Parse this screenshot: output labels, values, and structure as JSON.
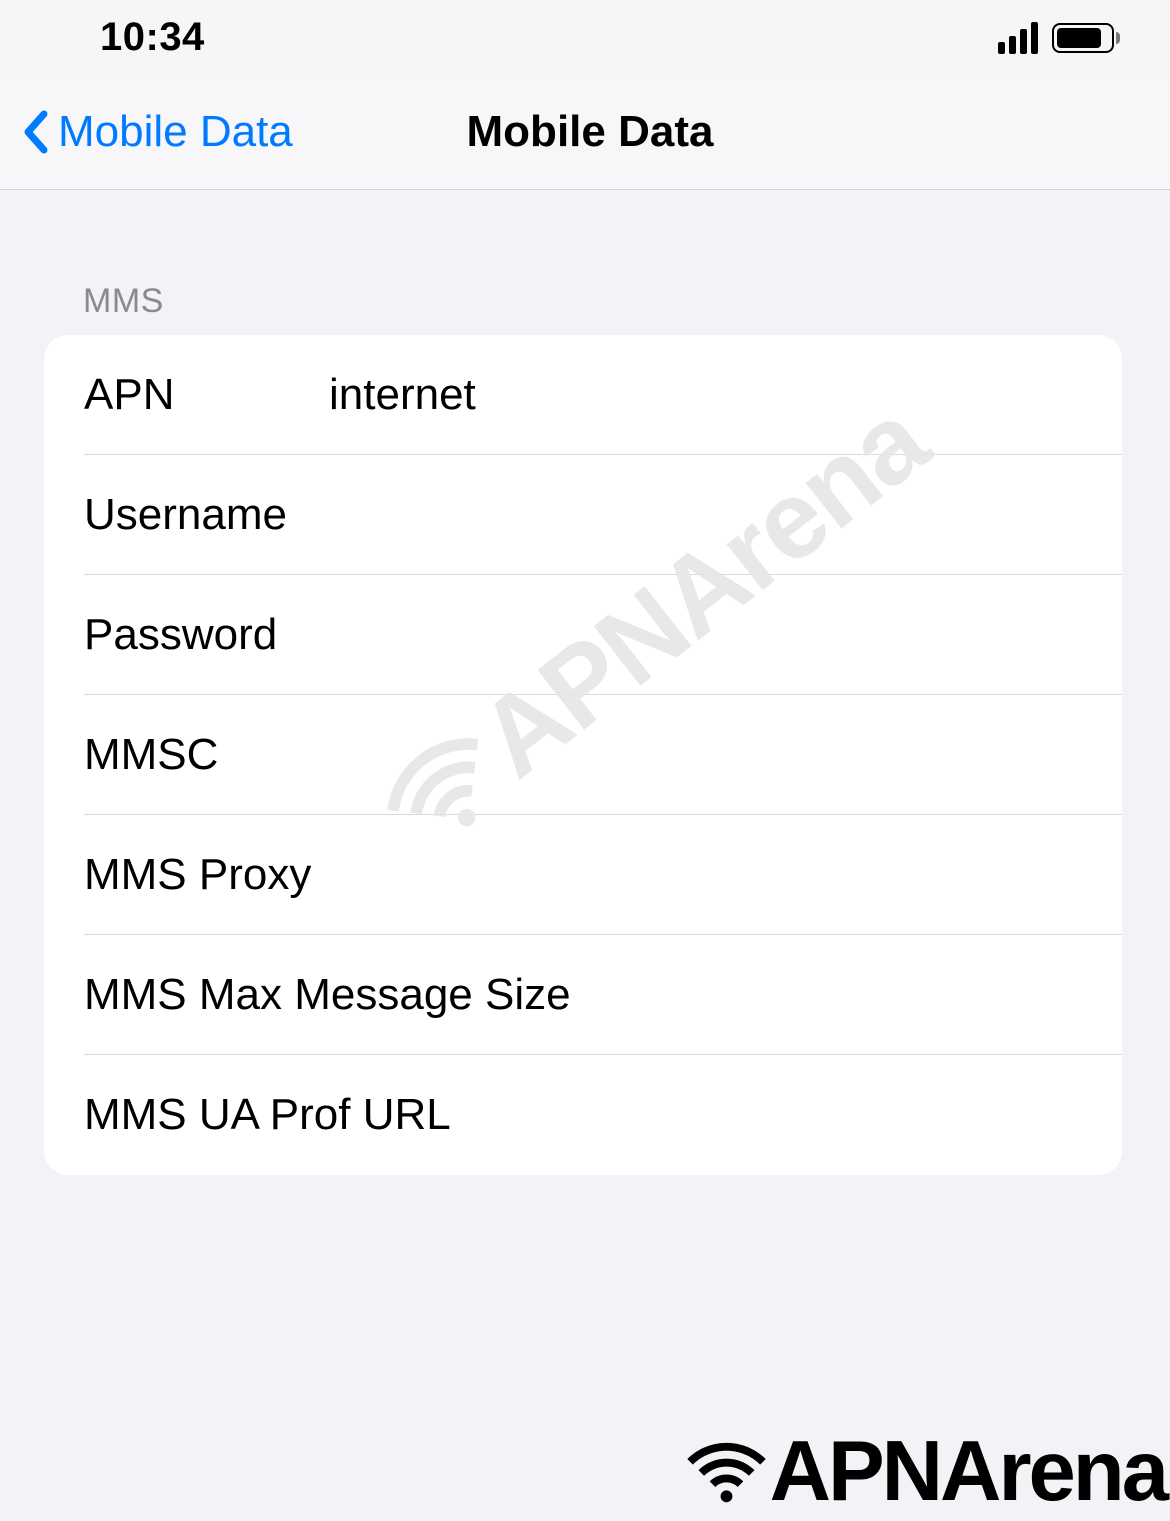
{
  "status": {
    "time": "10:34"
  },
  "nav": {
    "back_label": "Mobile Data",
    "title": "Mobile Data"
  },
  "section": {
    "header": "MMS",
    "rows": [
      {
        "label": "APN",
        "value": "internet"
      },
      {
        "label": "Username",
        "value": ""
      },
      {
        "label": "Password",
        "value": ""
      },
      {
        "label": "MMSC",
        "value": ""
      },
      {
        "label": "MMS Proxy",
        "value": ""
      },
      {
        "label": "MMS Max Message Size",
        "value": ""
      },
      {
        "label": "MMS UA Prof URL",
        "value": ""
      }
    ]
  },
  "watermark": {
    "text": "APNArena"
  },
  "footer": {
    "text": "APNArena"
  }
}
